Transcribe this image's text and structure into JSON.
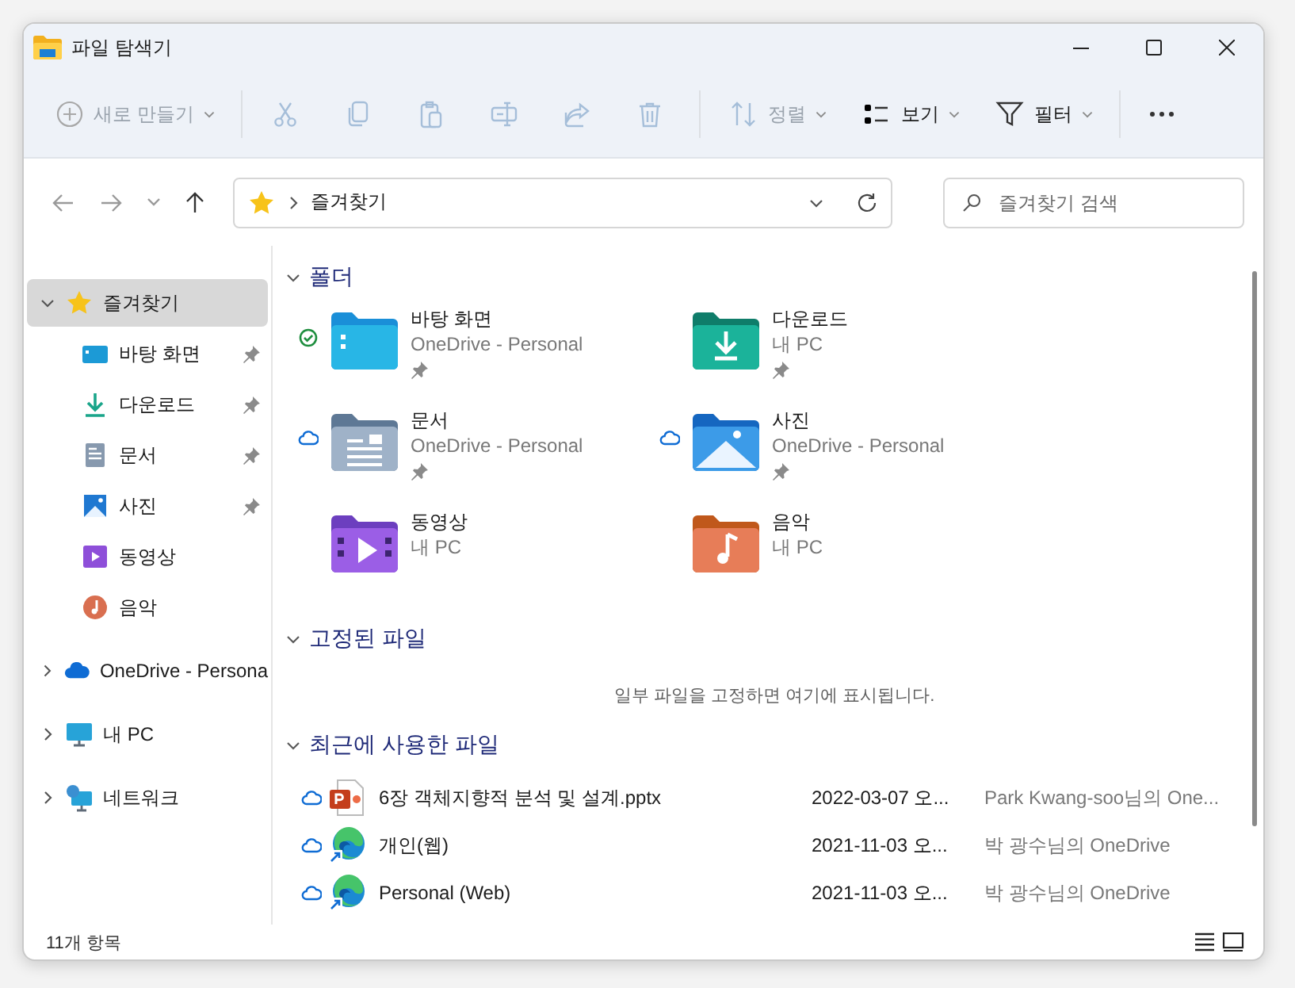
{
  "window": {
    "title": "파일 탐색기"
  },
  "toolbar": {
    "items": [
      {
        "kind": "new",
        "label": "새로 만들기",
        "disabled": true
      },
      {
        "kind": "cut",
        "disabled": true
      },
      {
        "kind": "copy",
        "disabled": true
      },
      {
        "kind": "paste",
        "disabled": true
      },
      {
        "kind": "rename",
        "disabled": true
      },
      {
        "kind": "share",
        "disabled": true
      },
      {
        "kind": "delete",
        "disabled": true
      },
      {
        "kind": "sort",
        "label": "정렬",
        "disabled": true
      },
      {
        "kind": "view",
        "label": "보기",
        "disabled": false
      },
      {
        "kind": "filter",
        "label": "필터",
        "disabled": false
      },
      {
        "kind": "more",
        "disabled": false
      }
    ]
  },
  "address": {
    "path": "즐겨찾기"
  },
  "search": {
    "placeholder": "즐겨찾기 검색"
  },
  "sidebar": {
    "items": [
      {
        "label": "즐겨찾기",
        "kind": "star",
        "expanded": true,
        "selected": true,
        "children": [
          {
            "label": "바탕 화면",
            "kind": "desktop",
            "pinned": true,
            "selected": false
          },
          {
            "label": "다운로드",
            "kind": "download",
            "pinned": true,
            "selected": false
          },
          {
            "label": "문서",
            "kind": "documents",
            "pinned": true,
            "selected": false
          },
          {
            "label": "사진",
            "kind": "pictures",
            "pinned": true,
            "selected": false
          },
          {
            "label": "동영상",
            "kind": "videos",
            "pinned": false,
            "selected": false
          },
          {
            "label": "음악",
            "kind": "music",
            "pinned": false,
            "selected": false
          }
        ]
      },
      {
        "label": "OneDrive - Persona",
        "kind": "cloud",
        "expanded": false,
        "selected": false
      },
      {
        "label": "내 PC",
        "kind": "pc",
        "expanded": false,
        "selected": false
      },
      {
        "label": "네트워크",
        "kind": "network",
        "expanded": false,
        "selected": false
      }
    ]
  },
  "sections": [
    {
      "kind": "folders",
      "title": "폴더",
      "expanded": true,
      "folders": [
        {
          "name": "바탕 화면",
          "location": "OneDrive - Personal",
          "kind": "desktop",
          "synced": true,
          "cloud_only": false,
          "pinned": true
        },
        {
          "name": "다운로드",
          "location": "내 PC",
          "kind": "download",
          "synced": false,
          "cloud_only": false,
          "pinned": true
        },
        {
          "name": "문서",
          "location": "OneDrive - Personal",
          "kind": "documents",
          "synced": false,
          "cloud_only": true,
          "pinned": true
        },
        {
          "name": "사진",
          "location": "OneDrive - Personal",
          "kind": "pictures",
          "synced": false,
          "cloud_only": true,
          "pinned": true
        },
        {
          "name": "동영상",
          "location": "내 PC",
          "kind": "videos",
          "synced": false,
          "cloud_only": false,
          "pinned": false
        },
        {
          "name": "음악",
          "location": "내 PC",
          "kind": "music",
          "synced": false,
          "cloud_only": false,
          "pinned": false
        }
      ]
    },
    {
      "kind": "pinned",
      "title": "고정된 파일",
      "expanded": true,
      "empty_message": "일부 파일을 고정하면 여기에 표시됩니다."
    },
    {
      "kind": "recent",
      "title": "최근에 사용한 파일",
      "expanded": true,
      "files": [
        {
          "name": "6장 객체지향적 분석 및 설계.pptx",
          "date": "2022-03-07 오...",
          "location": "Park Kwang-soo님의 One...",
          "kind": "pptx",
          "cloud_only": true
        },
        {
          "name": "개인(웹)",
          "date": "2021-11-03 오...",
          "location": "박 광수님의 OneDrive",
          "kind": "edge",
          "cloud_only": true
        },
        {
          "name": "Personal (Web)",
          "date": "2021-11-03 오...",
          "location": "박 광수님의 OneDrive",
          "kind": "edge",
          "cloud_only": true
        }
      ]
    }
  ],
  "status_bar": {
    "count": "11개 항목"
  }
}
